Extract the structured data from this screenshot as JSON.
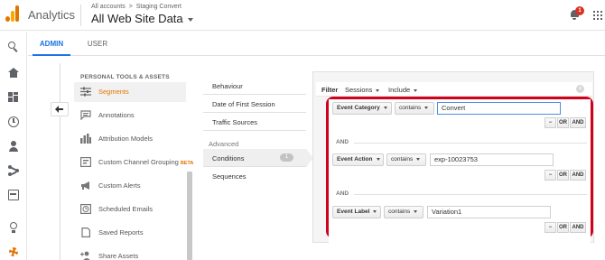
{
  "header": {
    "app_name": "Analytics",
    "breadcrumb_root": "All accounts",
    "breadcrumb_separator": ">",
    "breadcrumb_account": "Staging Convert",
    "view_name": "All Web Site Data",
    "notification_count": "1"
  },
  "rail": {
    "icons": [
      "search-icon",
      "home-icon",
      "dashboard-icon",
      "clock-icon",
      "person-icon",
      "flow-icon",
      "card-icon",
      "lightbulb-icon",
      "gear-icon"
    ],
    "active": "gear-icon",
    "accent": "#e37400"
  },
  "tabs": {
    "admin": "ADMIN",
    "user": "USER"
  },
  "admin_menu": {
    "section": "PERSONAL TOOLS & ASSETS",
    "items": [
      {
        "label": "Segments",
        "icon": "segments-icon",
        "active": true
      },
      {
        "label": "Annotations",
        "icon": "annotation-icon"
      },
      {
        "label": "Attribution Models",
        "icon": "bar-chart-icon"
      },
      {
        "label": "Custom Channel Grouping",
        "icon": "channel-icon",
        "badge": "BETA"
      },
      {
        "label": "Custom Alerts",
        "icon": "megaphone-icon"
      },
      {
        "label": "Scheduled Emails",
        "icon": "clock-icon"
      },
      {
        "label": "Saved Reports",
        "icon": "document-icon"
      },
      {
        "label": "Share Assets",
        "icon": "add-person-icon"
      }
    ]
  },
  "segment_editor": {
    "nav": [
      "Behaviour",
      "Date of First Session",
      "Traffic Sources"
    ],
    "advanced_group": "Advanced",
    "conditions_label": "Conditions",
    "conditions_count": "1",
    "sequences_label": "Sequences"
  },
  "filter": {
    "label": "Filter",
    "scope": "Sessions",
    "mode": "Include",
    "and_label": "AND",
    "or_label": "OR",
    "minus_label": "−",
    "rows": [
      {
        "dimension": "Event Category",
        "operator": "contains",
        "value": "Convert"
      },
      {
        "dimension": "Event Action",
        "operator": "contains",
        "value": "exp-10023753"
      },
      {
        "dimension": "Event Label",
        "operator": "contains",
        "value": "Variation1"
      }
    ],
    "highlight_color": "#d0021b"
  }
}
